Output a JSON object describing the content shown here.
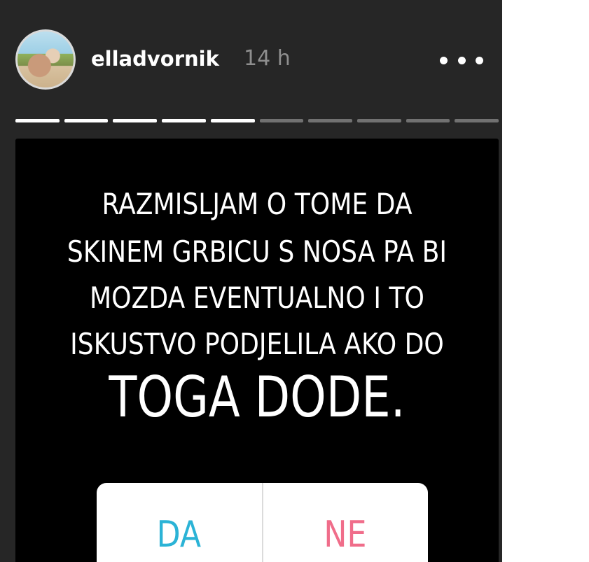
{
  "header": {
    "username": "elladvornik",
    "timestamp": "14 h",
    "menu_icon": "more-horizontal-icon",
    "avatar_icon": "profile-photo"
  },
  "progress": {
    "total_segments": 10,
    "completed_segments": 5
  },
  "story": {
    "lines": [
      "RAZMISLJAM O TOME DA",
      "SKINEM GRBICU S NOSA PA BI",
      "MOZDA EVENTUALNO I TO",
      "ISKUSTVO PODJELILA AKO DO",
      "TOGA DODE."
    ],
    "poll": {
      "option_yes": "DA",
      "option_no": "NE"
    }
  },
  "colors": {
    "background": "#262626",
    "media": "#000000",
    "poll_yes": "#2bb3d6",
    "poll_no": "#f06d8a"
  }
}
